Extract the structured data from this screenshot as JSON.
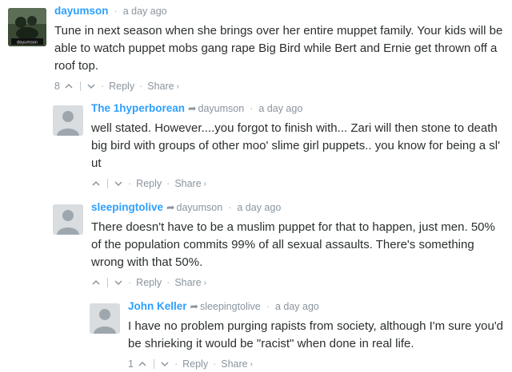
{
  "comments": [
    {
      "author": "dayumson",
      "reply_to": "",
      "time": "a day ago",
      "text": "Tune in next season when she brings over her entire muppet family. Your kids will be able to watch puppet mobs gang rape Big Bird while Bert and Ernie get thrown off a roof top.",
      "votes": "8",
      "avatar_caption": "dayumson",
      "actions": {
        "reply": "Reply",
        "share": "Share",
        "share_chevron": "›",
        "separator": "·"
      }
    },
    {
      "author": "The 1hyperborean",
      "reply_to": "dayumson",
      "time": "a day ago",
      "text": "well stated. However....you forgot to finish with... Zari will then stone to death big bird with groups of other moo' slime girl puppets.. you know for being a sl' ut",
      "votes": "",
      "actions": {
        "reply": "Reply",
        "share": "Share",
        "share_chevron": "›",
        "separator": "·"
      }
    },
    {
      "author": "sleepingtolive",
      "reply_to": "dayumson",
      "time": "a day ago",
      "text": "There doesn't have to be a muslim puppet for that to happen, just men. 50% of the population commits 99% of all sexual assaults. There's something wrong with that 50%.",
      "votes": "",
      "actions": {
        "reply": "Reply",
        "share": "Share",
        "share_chevron": "›",
        "separator": "·"
      }
    },
    {
      "author": "John Keller",
      "reply_to": "sleepingtolive",
      "time": "a day ago",
      "text": "I have no problem purging rapists from society, although I'm sure you'd be shrieking it would be \"racist\" when done in real life.",
      "votes": "1",
      "actions": {
        "reply": "Reply",
        "share": "Share",
        "share_chevron": "›",
        "separator": "·"
      }
    }
  ],
  "icons": {
    "reply_arrow": "reply-arrow-icon",
    "upvote": "upvote-icon",
    "downvote": "downvote-icon",
    "avatar": "default-avatar-icon"
  },
  "colors": {
    "author": "#2e9fff",
    "meta": "#8a949e",
    "text": "#2a2e2e",
    "avatar_bg": "#d9dde0"
  }
}
